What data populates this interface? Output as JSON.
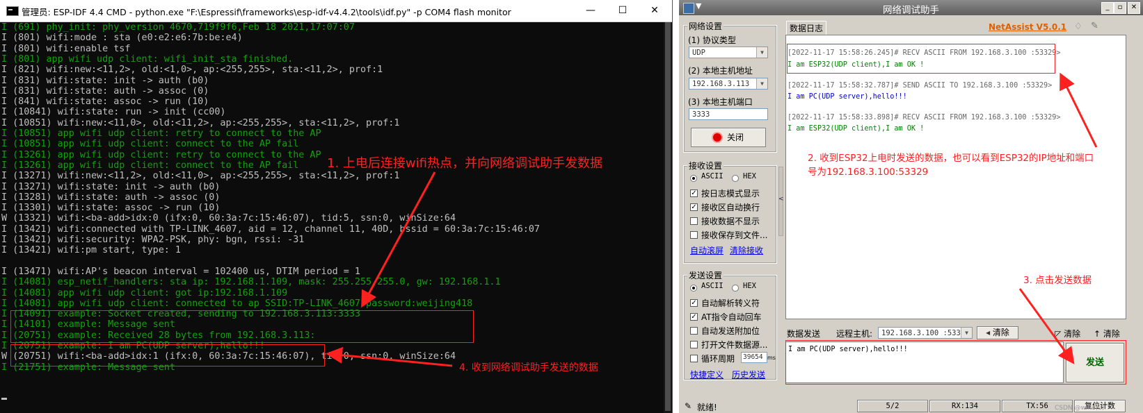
{
  "cmd": {
    "title": "管理员: ESP-IDF 4.4 CMD - python.exe  \"F:\\Espressif\\frameworks\\esp-idf-v4.4.2\\tools\\idf.py\" -p COM4 flash monitor",
    "min_glyph": "—",
    "max_glyph": "☐",
    "close_glyph": "✕",
    "lines": [
      {
        "text": "I (691) phy_init: phy_version 4670,719f9f6,Feb 18 2021,17:07:07",
        "color": "g"
      },
      {
        "text": "I (801) wifi:mode : sta (e0:e2:e6:7b:be:e4)",
        "color": "w"
      },
      {
        "text": "I (801) wifi:enable tsf",
        "color": "w"
      },
      {
        "text": "I (801) app wifi udp client: wifi_init_sta finished.",
        "color": "g"
      },
      {
        "text": "I (821) wifi:new:<11,2>, old:<1,0>, ap:<255,255>, sta:<11,2>, prof:1",
        "color": "w"
      },
      {
        "text": "I (831) wifi:state: init -> auth (b0)",
        "color": "w"
      },
      {
        "text": "I (831) wifi:state: auth -> assoc (0)",
        "color": "w"
      },
      {
        "text": "I (841) wifi:state: assoc -> run (10)",
        "color": "w"
      },
      {
        "text": "I (10841) wifi:state: run -> init (cc00)",
        "color": "w"
      },
      {
        "text": "I (10851) wifi:new:<11,0>, old:<11,2>, ap:<255,255>, sta:<11,2>, prof:1",
        "color": "w"
      },
      {
        "text": "I (10851) app wifi udp client: retry to connect to the AP",
        "color": "g"
      },
      {
        "text": "I (10851) app wifi udp client: connect to the AP fail",
        "color": "g"
      },
      {
        "text": "I (13261) app wifi udp client: retry to connect to the AP",
        "color": "g"
      },
      {
        "text": "I (13261) app wifi udp client: connect to the AP fail",
        "color": "g"
      },
      {
        "text": "I (13271) wifi:new:<11,2>, old:<11,0>, ap:<255,255>, sta:<11,2>, prof:1",
        "color": "w"
      },
      {
        "text": "I (13271) wifi:state: init -> auth (b0)",
        "color": "w"
      },
      {
        "text": "I (13281) wifi:state: auth -> assoc (0)",
        "color": "w"
      },
      {
        "text": "I (13301) wifi:state: assoc -> run (10)",
        "color": "w"
      },
      {
        "text": "W (13321) wifi:<ba-add>idx:0 (ifx:0, 60:3a:7c:15:46:07), tid:5, ssn:0, winSize:64",
        "color": "w"
      },
      {
        "text": "I (13421) wifi:connected with TP-LINK_4607, aid = 12, channel 11, 40D, bssid = 60:3a:7c:15:46:07",
        "color": "w"
      },
      {
        "text": "I (13421) wifi:security: WPA2-PSK, phy: bgn, rssi: -31",
        "color": "w"
      },
      {
        "text": "I (13421) wifi:pm start, type: 1",
        "color": "w"
      },
      {
        "text": "",
        "color": "w"
      },
      {
        "text": "I (13471) wifi:AP's beacon interval = 102400 us, DTIM period = 1",
        "color": "w"
      },
      {
        "text": "I (14081) esp_netif_handlers: sta ip: 192.168.1.109, mask: 255.255.255.0, gw: 192.168.1.1",
        "color": "g"
      },
      {
        "text": "I (14081) app wifi udp client: got ip:192.168.1.109",
        "color": "g"
      },
      {
        "text": "I (14081) app wifi udp client: connected to ap SSID:TP-LINK_4607 password:weijing418",
        "color": "g"
      },
      {
        "text": "I (14091) example: Socket created, sending to 192.168.3.113:3333",
        "color": "g"
      },
      {
        "text": "I (14101) example: Message sent",
        "color": "g"
      },
      {
        "text": "I (20751) example: Received 28 bytes from 192.168.3.113:",
        "color": "g"
      },
      {
        "text": "I (20751) example: I am PC(UDP server),hello!!!",
        "color": "g"
      },
      {
        "text": "W (20751) wifi:<ba-add>idx:1 (ifx:0, 60:3a:7c:15:46:07), tid:0, ssn:0, winSize:64",
        "color": "w"
      },
      {
        "text": "I (21751) example: Message sent",
        "color": "g"
      }
    ]
  },
  "annotations": {
    "a1": "1. 上电后连接wifi热点，并向网络调试助手发数据",
    "a2_line1": "2. 收到ESP32上电时发送的数据，也可以看到ESP32的IP地址和端口",
    "a2_line2": "号为192.168.3.100:53329",
    "a3": "3. 点击发送数据",
    "a4": "4. 收到网络调试助手发送的数据"
  },
  "netassist": {
    "title": "网络调试助手",
    "brand": "NetAssist V5.0.1",
    "net_settings": {
      "legend": "网络设置",
      "protocol_label": "(1) 协议类型",
      "protocol_value": "UDP",
      "local_host_label": "(2) 本地主机地址",
      "local_host_value": "192.168.3.113",
      "local_port_label": "(3) 本地主机端口",
      "local_port_value": "3333",
      "close_button": "关闭"
    },
    "recv_settings": {
      "legend": "接收设置",
      "ascii": "ASCII",
      "hex": "HEX",
      "opt1": "按日志模式显示",
      "opt2": "接收区自动换行",
      "opt3": "接收数据不显示",
      "opt4": "接收保存到文件...",
      "link1": "自动滚屏",
      "link2": "清除接收"
    },
    "send_settings": {
      "legend": "发送设置",
      "ascii": "ASCII",
      "hex": "HEX",
      "opt1": "自动解析转义符",
      "opt2": "AT指令自动回车",
      "opt3": "自动发送附加位",
      "opt4": "打开文件数据源...",
      "opt5": "循环周期",
      "period_value": "39654",
      "period_unit": "ms",
      "link1": "快捷定义",
      "link2": "历史发送"
    },
    "log_tab": "数据日志",
    "log": [
      {
        "header": "[2022-11-17 15:58:26.245]# RECV ASCII FROM 192.168.3.100 :53329>",
        "body": "I am  ESP32(UDP client),I am OK !",
        "kind": "recv"
      },
      {
        "header": "[2022-11-17 15:58:32.787]# SEND ASCII TO 192.168.3.100 :53329>",
        "body": "I am PC(UDP server),hello!!!",
        "kind": "send"
      },
      {
        "header": "[2022-11-17 15:58:33.898]# RECV ASCII FROM 192.168.3.100 :53329>",
        "body": "I am  ESP32(UDP client),I am OK !",
        "kind": "recv"
      }
    ],
    "send_bar": {
      "tab": "数据发送",
      "remote_label": "远程主机:",
      "remote_value": "192.168.3.100 :53329",
      "clear1": "清除",
      "clear2": "清除",
      "clear3": "清除",
      "input_value": "I am PC(UDP server),hello!!!",
      "send_button": "发送"
    },
    "status": {
      "ready": "就绪!",
      "count": "5/2",
      "rx": "RX:134",
      "tx": "TX:56",
      "reset": "复位计数"
    },
    "watermark": "CSDN @wifle(1)"
  },
  "colors": {
    "annotation_red": "#ff2020",
    "terminal_green": "#13a10e",
    "terminal_white": "#c0c0c0",
    "brand_orange": "#e06000"
  }
}
